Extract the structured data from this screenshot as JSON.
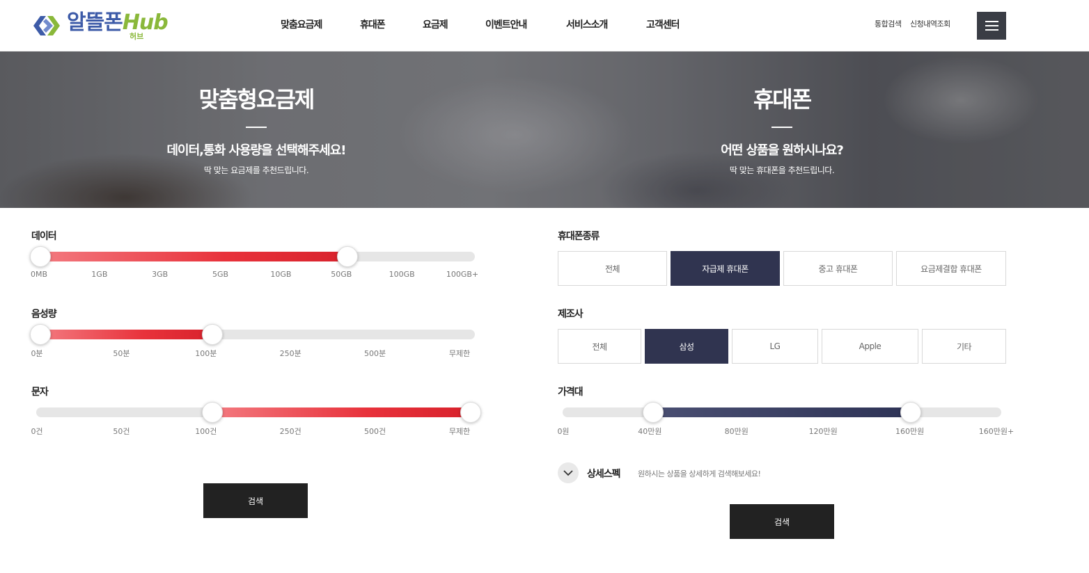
{
  "header": {
    "logo_main": "알뜰폰",
    "logo_hub": "Hub",
    "logo_sub": "허브",
    "nav": [
      "맞춤요금제",
      "휴대폰",
      "요금제",
      "이벤트안내",
      "서비스소개",
      "고객센터"
    ],
    "util": [
      "통합검색",
      "신청내역조회"
    ]
  },
  "banner": {
    "left": {
      "title": "맞춤형요금제",
      "subtitle": "데이터,통화 사용량을 선택해주세요!",
      "desc": "딱 맞는 요금제를 추천드립니다."
    },
    "right": {
      "title": "휴대폰",
      "subtitle": "어떤 상품을 원하시나요?",
      "desc": "딱 맞는 휴대폰을 추천드립니다."
    }
  },
  "plan": {
    "data": {
      "label": "데이터",
      "ticks": [
        "0MB",
        "1GB",
        "3GB",
        "5GB",
        "10GB",
        "50GB",
        "100GB",
        "100GB+"
      ],
      "range": [
        0,
        5
      ]
    },
    "voice": {
      "label": "음성량",
      "ticks": [
        "0분",
        "50분",
        "100분",
        "250분",
        "500분",
        "무제한"
      ],
      "range": [
        0,
        2
      ]
    },
    "sms": {
      "label": "문자",
      "ticks": [
        "0건",
        "50건",
        "100건",
        "250건",
        "500건",
        "무제한"
      ],
      "range": [
        2,
        5
      ]
    },
    "search_label": "검색"
  },
  "phone": {
    "type": {
      "label": "휴대폰종류",
      "options": [
        "전체",
        "자급제 휴대폰",
        "중고 휴대폰",
        "요금제결합 휴대폰"
      ],
      "selected": "자급제 휴대폰"
    },
    "maker": {
      "label": "제조사",
      "options": [
        "전체",
        "삼성",
        "LG",
        "Apple",
        "기타"
      ],
      "selected": "삼성"
    },
    "price": {
      "label": "가격대",
      "ticks": [
        "0원",
        "40만원",
        "80만원",
        "120만원",
        "160만원",
        "160만원+"
      ],
      "range": [
        1,
        4
      ]
    },
    "spec": {
      "title": "상세스펙",
      "desc": "원하시는 상품을 상세하게 검색해보세요!"
    },
    "search_label": "검색"
  },
  "colors": {
    "accent_red": "#e8323b",
    "accent_navy": "#303450",
    "logo_blue": "#3d5ba8",
    "logo_green": "#8ab83a"
  }
}
